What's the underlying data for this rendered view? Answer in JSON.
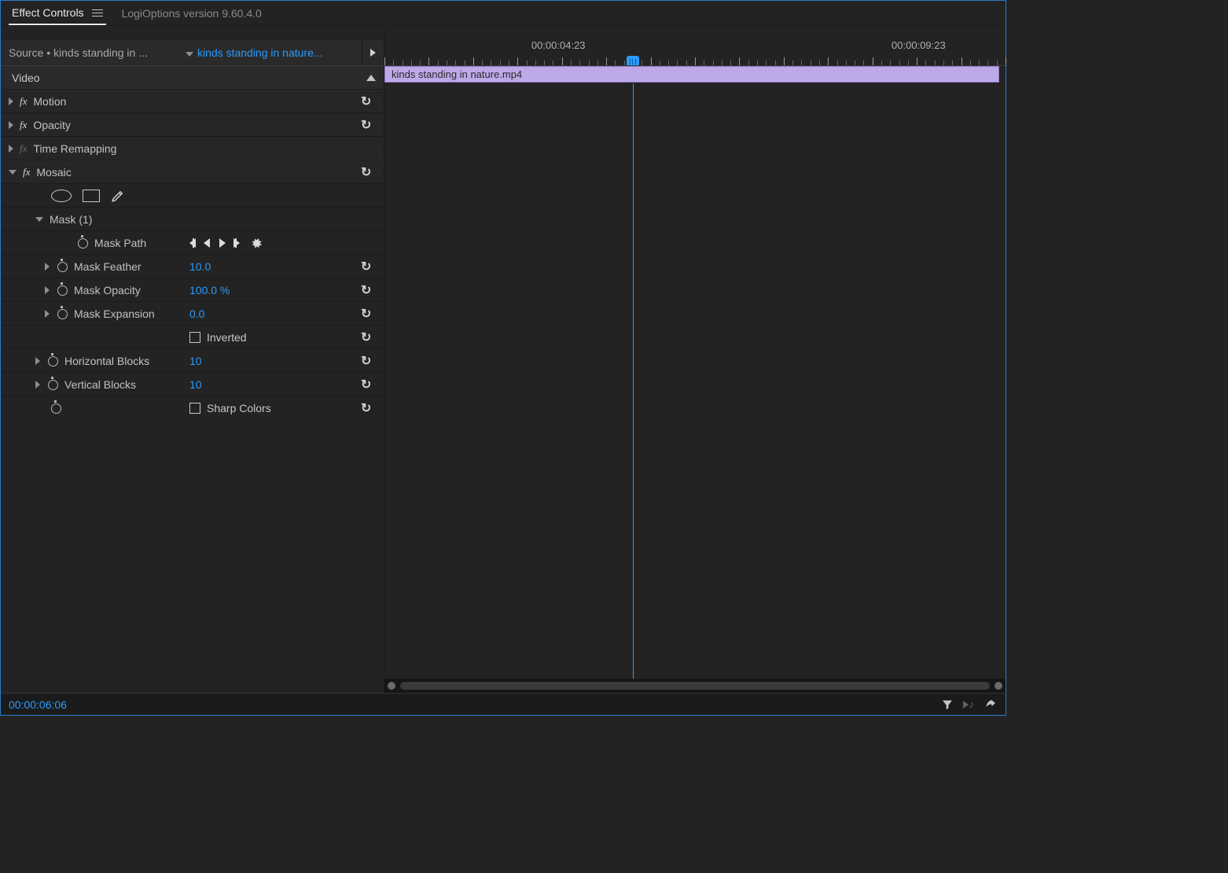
{
  "tabs": {
    "active": "Effect Controls",
    "secondary": "LogiOptions version 9.60.4.0"
  },
  "source": {
    "prefix": "Source • kinds standing in ...",
    "sequence": "kinds standing in nature..."
  },
  "section_header": "Video",
  "effects": {
    "motion": {
      "label": "Motion"
    },
    "opacity": {
      "label": "Opacity"
    },
    "timeremap": {
      "label": "Time Remapping"
    },
    "mosaic": {
      "label": "Mosaic",
      "mask": {
        "label": "Mask (1)",
        "path_label": "Mask Path",
        "feather": {
          "label": "Mask Feather",
          "value": "10.0"
        },
        "opacity": {
          "label": "Mask Opacity",
          "value": "100.0 %"
        },
        "expansion": {
          "label": "Mask Expansion",
          "value": "0.0"
        },
        "inverted_label": "Inverted"
      },
      "hblocks": {
        "label": "Horizontal Blocks",
        "value": "10"
      },
      "vblocks": {
        "label": "Vertical Blocks",
        "value": "10"
      },
      "sharp_label": "Sharp Colors"
    }
  },
  "timeline": {
    "labels": [
      {
        "text": "00:00:04:23",
        "pos_pct": 28
      },
      {
        "text": "00:00:09:23",
        "pos_pct": 86
      }
    ],
    "playhead_pct": 40,
    "clip_name": "kinds standing in nature.mp4"
  },
  "status": {
    "timecode": "00:00:06:06"
  }
}
